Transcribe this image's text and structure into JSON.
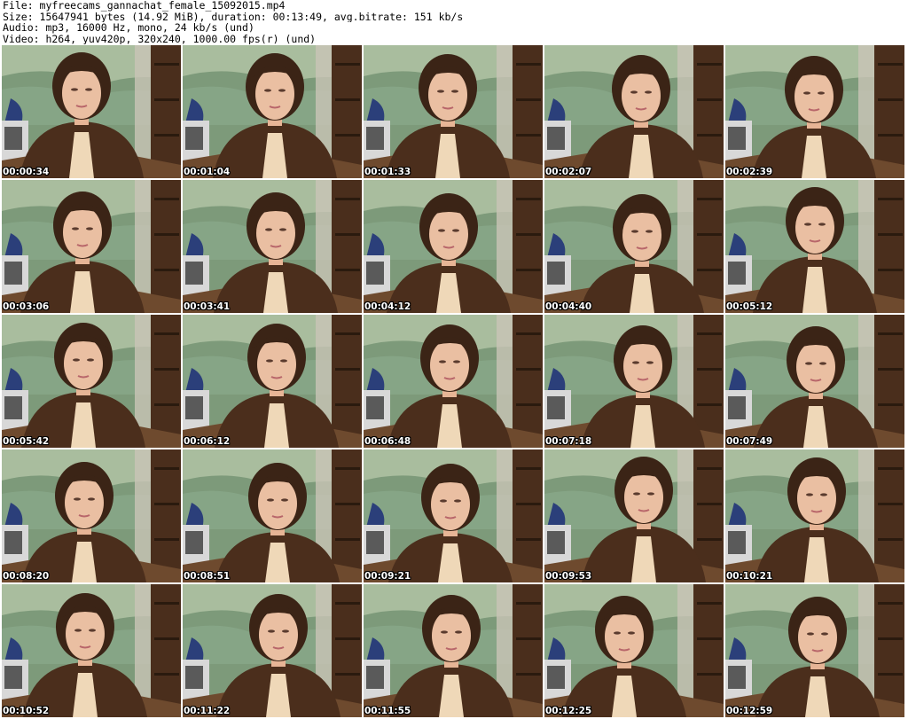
{
  "header": {
    "file_line": "File: myfreecams_gannachat_female_15092015.mp4",
    "size_line": "Size: 15647941 bytes (14.92 MiB), duration: 00:13:49, avg.bitrate: 151 kb/s",
    "audio_line": "Audio: mp3, 16000 Hz, mono, 24 kb/s (und)",
    "video_line": "Video: h264, yuv420p, 320x240, 1000.00 fps(r) (und)"
  },
  "thumbnails": [
    {
      "timestamp": "00:00:34"
    },
    {
      "timestamp": "00:01:04"
    },
    {
      "timestamp": "00:01:33"
    },
    {
      "timestamp": "00:02:07"
    },
    {
      "timestamp": "00:02:39"
    },
    {
      "timestamp": "00:03:06"
    },
    {
      "timestamp": "00:03:41"
    },
    {
      "timestamp": "00:04:12"
    },
    {
      "timestamp": "00:04:40"
    },
    {
      "timestamp": "00:05:12"
    },
    {
      "timestamp": "00:05:42"
    },
    {
      "timestamp": "00:06:12"
    },
    {
      "timestamp": "00:06:48"
    },
    {
      "timestamp": "00:07:18"
    },
    {
      "timestamp": "00:07:49"
    },
    {
      "timestamp": "00:08:20"
    },
    {
      "timestamp": "00:08:51"
    },
    {
      "timestamp": "00:09:21"
    },
    {
      "timestamp": "00:09:53"
    },
    {
      "timestamp": "00:10:21"
    },
    {
      "timestamp": "00:10:52"
    },
    {
      "timestamp": "00:11:22"
    },
    {
      "timestamp": "00:11:55"
    },
    {
      "timestamp": "00:12:25"
    },
    {
      "timestamp": "00:12:59"
    }
  ]
}
